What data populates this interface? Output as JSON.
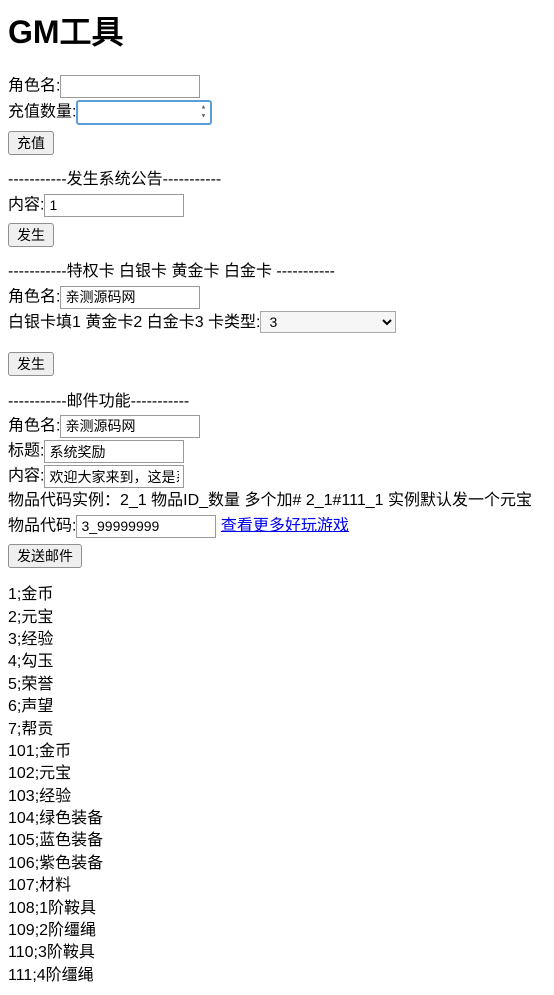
{
  "title": "GM工具",
  "recharge": {
    "role_label": "角色名:",
    "role_value": "",
    "amount_label": "充值数量:",
    "amount_value": "",
    "submit_label": "充值"
  },
  "announcement": {
    "separator": "-----------发生系统公告-----------",
    "content_label": "内容:",
    "content_value": "1",
    "submit_label": "发生"
  },
  "card": {
    "separator": "-----------特权卡 白银卡 黄金卡 白金卡 -----------",
    "role_label": "角色名:",
    "role_value": "亲测源码网",
    "hint": "白银卡填1 黄金卡2 白金卡3 卡类型:",
    "type_value": "3",
    "submit_label": "发生"
  },
  "mail": {
    "separator": "-----------邮件功能-----------",
    "role_label": "角色名:",
    "role_value": "亲测源码网",
    "title_label": "标题:",
    "title_value": "系统奖励",
    "content_label": "内容:",
    "content_value": "欢迎大家来到，这是系统",
    "example": "物品代码实例：2_1 物品ID_数量 多个加# 2_1#111_1 实例默认发一个元宝",
    "code_label": "物品代码:",
    "code_value": "3_99999999",
    "link_text": "查看更多好玩游戏",
    "submit_label": "发送邮件"
  },
  "items": [
    "1;金币",
    "2;元宝",
    "3;经验",
    "4;勾玉",
    "5;荣誉",
    "6;声望",
    "7;帮贡",
    "101;金币",
    "102;元宝",
    "103;经验",
    "104;绿色装备",
    "105;蓝色装备",
    "106;紫色装备",
    "107;材料",
    "108;1阶鞍具",
    "109;2阶缰绳",
    "110;3阶鞍具",
    "111;4阶缰绳"
  ]
}
